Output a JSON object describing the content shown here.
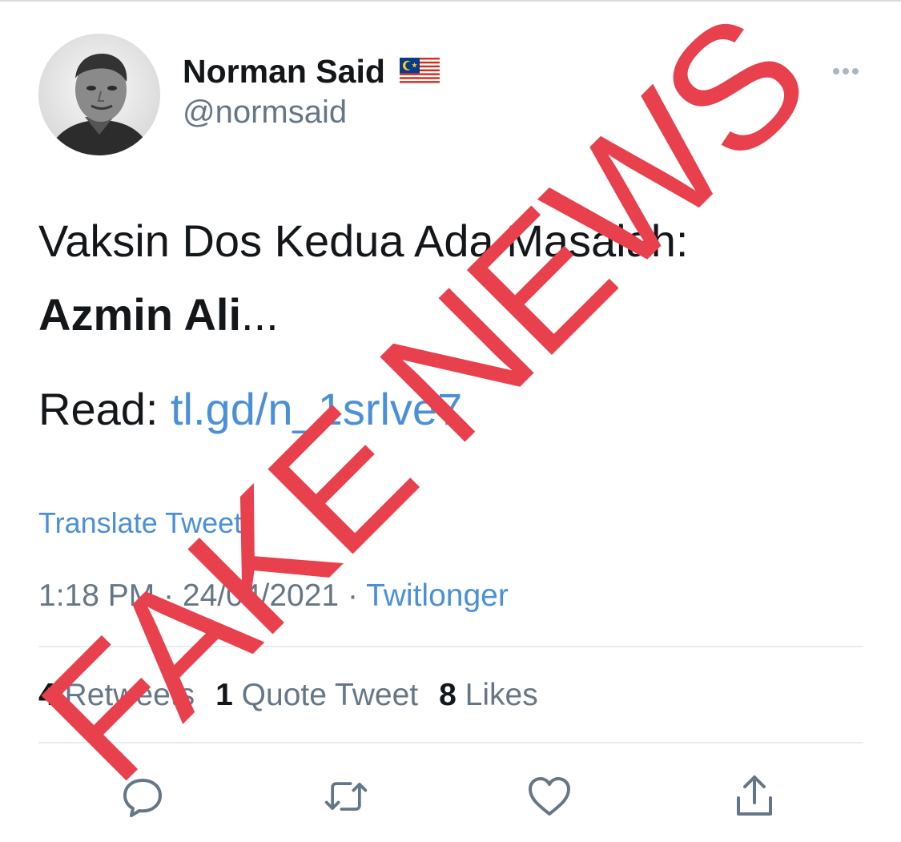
{
  "tweet": {
    "author": {
      "name": "Norman Said",
      "handle": "@normsaid",
      "flag_icon": "malaysia-flag-icon"
    },
    "text": {
      "line1": "Vaksin Dos Kedua Ada Masalah:",
      "line2_bold": "Azmin Ali",
      "line2_suffix": "...",
      "line3_prefix": "Read: ",
      "line3_link": "tl.gd/n_1srlve7"
    },
    "translate_label": "Translate Tweet",
    "meta": {
      "time": "1:18 PM",
      "separator": " · ",
      "date": "24/04/2021",
      "source": "Twitlonger"
    },
    "stats": {
      "retweets_count": "4",
      "retweets_label": "Retweets",
      "quotes_count": "1",
      "quotes_label": "Quote Tweet",
      "likes_count": "8",
      "likes_label": "Likes"
    },
    "actions": [
      "reply-icon",
      "retweet-icon",
      "like-icon",
      "share-icon"
    ]
  },
  "overlay_stamp": {
    "text": "FAKE NEWS",
    "color": "#e8404c"
  },
  "colors": {
    "link": "#4a90d9",
    "secondary_text": "#657786",
    "primary_text": "#14171a"
  }
}
